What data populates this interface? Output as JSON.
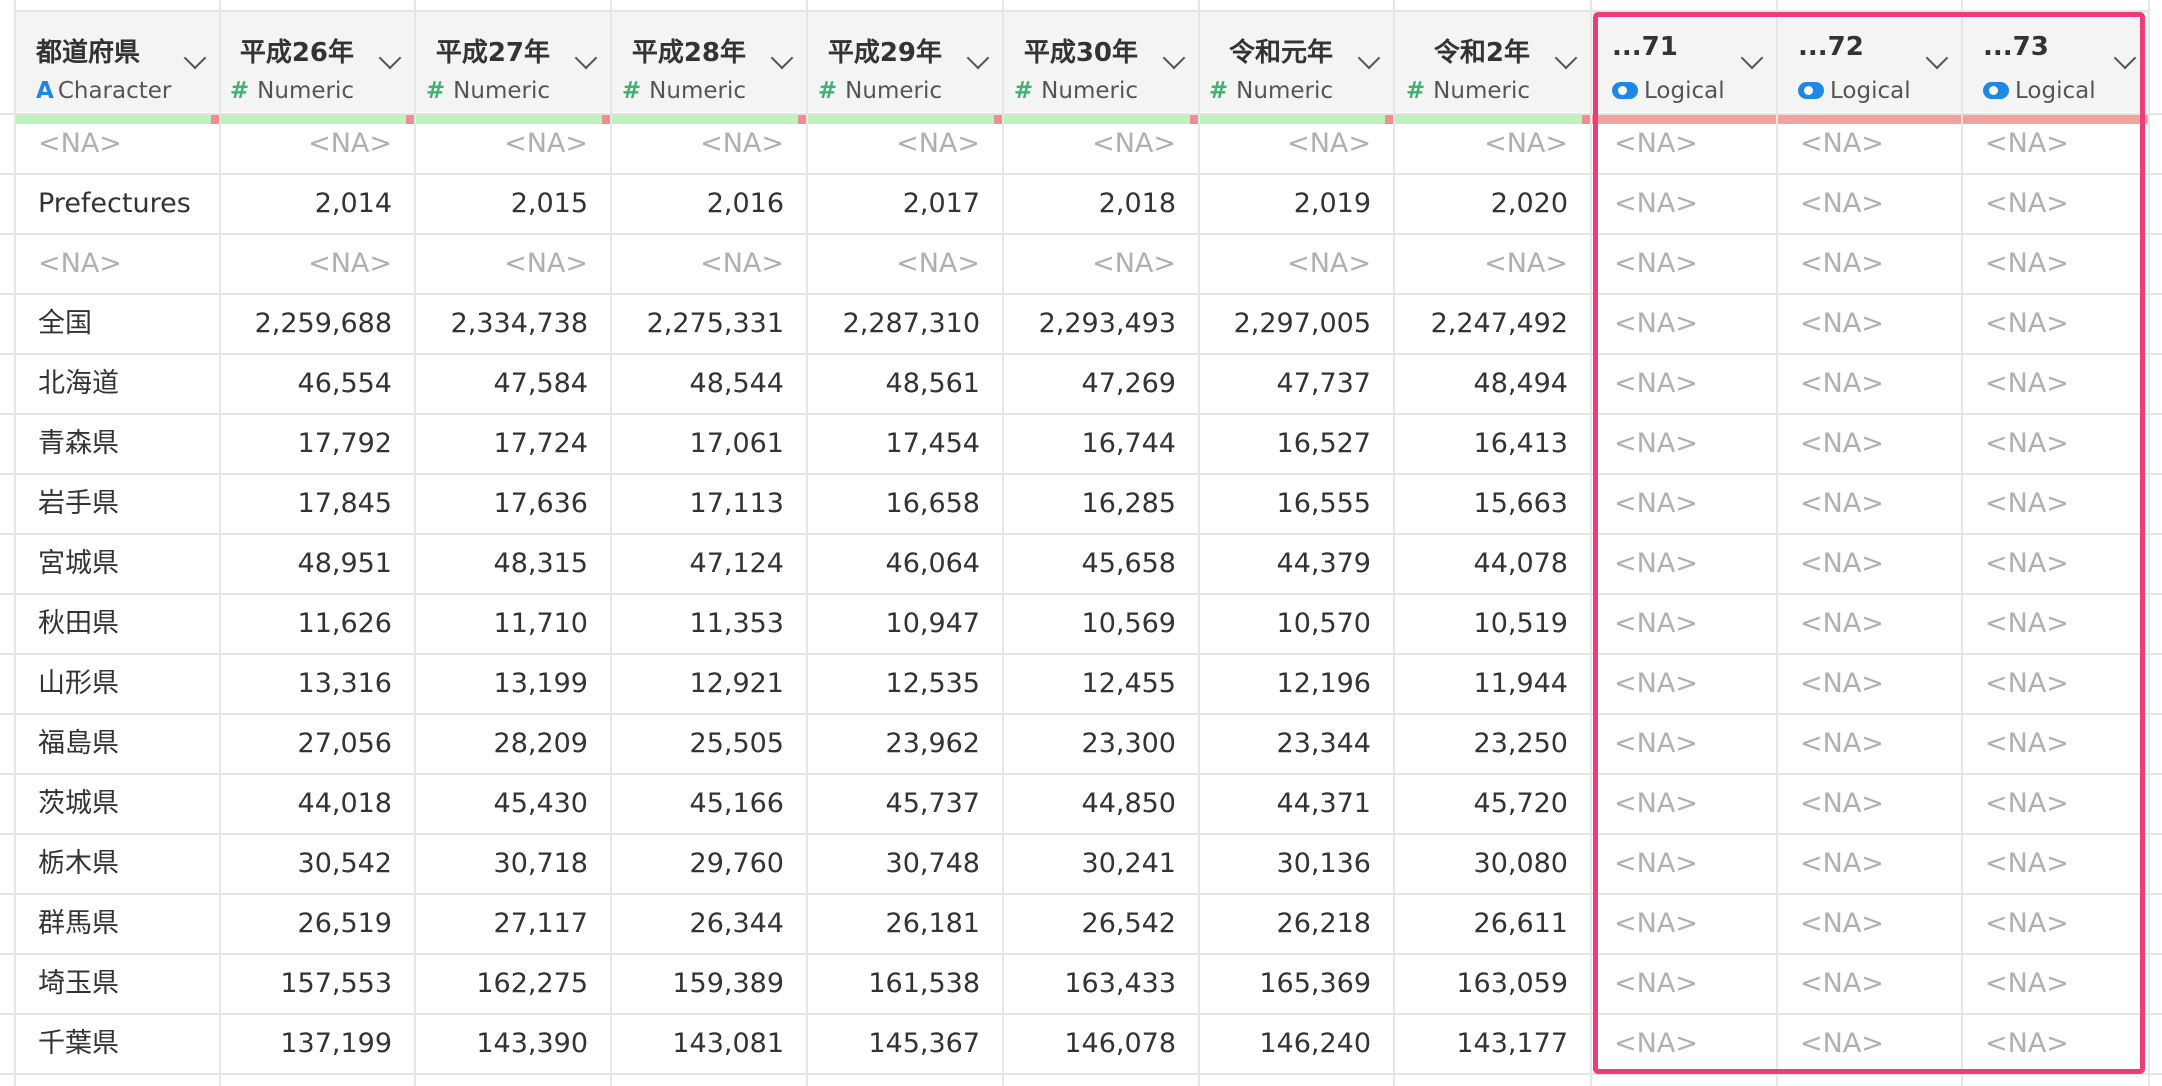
{
  "columns": [
    {
      "name": "都道府県",
      "type": "Character",
      "icon": "character-type-icon",
      "kind": "chr",
      "align": "left"
    },
    {
      "name": "平成26年",
      "type": "Numeric",
      "icon": "numeric-type-icon",
      "kind": "num",
      "align": "right"
    },
    {
      "name": "平成27年",
      "type": "Numeric",
      "icon": "numeric-type-icon",
      "kind": "num",
      "align": "right"
    },
    {
      "name": "平成28年",
      "type": "Numeric",
      "icon": "numeric-type-icon",
      "kind": "num",
      "align": "right"
    },
    {
      "name": "平成29年",
      "type": "Numeric",
      "icon": "numeric-type-icon",
      "kind": "num",
      "align": "right"
    },
    {
      "name": "平成30年",
      "type": "Numeric",
      "icon": "numeric-type-icon",
      "kind": "num",
      "align": "right"
    },
    {
      "name": "令和元年",
      "type": "Numeric",
      "icon": "numeric-type-icon",
      "kind": "num",
      "align": "right"
    },
    {
      "name": "令和2年",
      "type": "Numeric",
      "icon": "numeric-type-icon",
      "kind": "num",
      "align": "right"
    },
    {
      "name": "...71",
      "type": "Logical",
      "icon": "logical-type-icon",
      "kind": "log",
      "align": "left"
    },
    {
      "name": "...72",
      "type": "Logical",
      "icon": "logical-type-icon",
      "kind": "log",
      "align": "left"
    },
    {
      "name": "...73",
      "type": "Logical",
      "icon": "logical-type-icon",
      "kind": "log",
      "align": "left"
    }
  ],
  "na_text": "<NA>",
  "rows": [
    [
      "<NA>",
      "<NA>",
      "<NA>",
      "<NA>",
      "<NA>",
      "<NA>",
      "<NA>",
      "<NA>",
      "<NA>",
      "<NA>",
      "<NA>"
    ],
    [
      "Prefectures",
      "2,014",
      "2,015",
      "2,016",
      "2,017",
      "2,018",
      "2,019",
      "2,020",
      "<NA>",
      "<NA>",
      "<NA>"
    ],
    [
      "<NA>",
      "<NA>",
      "<NA>",
      "<NA>",
      "<NA>",
      "<NA>",
      "<NA>",
      "<NA>",
      "<NA>",
      "<NA>",
      "<NA>"
    ],
    [
      "全国",
      "2,259,688",
      "2,334,738",
      "2,275,331",
      "2,287,310",
      "2,293,493",
      "2,297,005",
      "2,247,492",
      "<NA>",
      "<NA>",
      "<NA>"
    ],
    [
      "北海道",
      "46,554",
      "47,584",
      "48,544",
      "48,561",
      "47,269",
      "47,737",
      "48,494",
      "<NA>",
      "<NA>",
      "<NA>"
    ],
    [
      "青森県",
      "17,792",
      "17,724",
      "17,061",
      "17,454",
      "16,744",
      "16,527",
      "16,413",
      "<NA>",
      "<NA>",
      "<NA>"
    ],
    [
      "岩手県",
      "17,845",
      "17,636",
      "17,113",
      "16,658",
      "16,285",
      "16,555",
      "15,663",
      "<NA>",
      "<NA>",
      "<NA>"
    ],
    [
      "宮城県",
      "48,951",
      "48,315",
      "47,124",
      "46,064",
      "45,658",
      "44,379",
      "44,078",
      "<NA>",
      "<NA>",
      "<NA>"
    ],
    [
      "秋田県",
      "11,626",
      "11,710",
      "11,353",
      "10,947",
      "10,569",
      "10,570",
      "10,519",
      "<NA>",
      "<NA>",
      "<NA>"
    ],
    [
      "山形県",
      "13,316",
      "13,199",
      "12,921",
      "12,535",
      "12,455",
      "12,196",
      "11,944",
      "<NA>",
      "<NA>",
      "<NA>"
    ],
    [
      "福島県",
      "27,056",
      "28,209",
      "25,505",
      "23,962",
      "23,300",
      "23,344",
      "23,250",
      "<NA>",
      "<NA>",
      "<NA>"
    ],
    [
      "茨城県",
      "44,018",
      "45,430",
      "45,166",
      "45,737",
      "44,850",
      "44,371",
      "45,720",
      "<NA>",
      "<NA>",
      "<NA>"
    ],
    [
      "栃木県",
      "30,542",
      "30,718",
      "29,760",
      "30,748",
      "30,241",
      "30,136",
      "30,080",
      "<NA>",
      "<NA>",
      "<NA>"
    ],
    [
      "群馬県",
      "26,519",
      "27,117",
      "26,344",
      "26,181",
      "26,542",
      "26,218",
      "26,611",
      "<NA>",
      "<NA>",
      "<NA>"
    ],
    [
      "埼玉県",
      "157,553",
      "162,275",
      "159,389",
      "161,538",
      "163,433",
      "165,369",
      "163,059",
      "<NA>",
      "<NA>",
      "<NA>"
    ],
    [
      "千葉県",
      "137,199",
      "143,390",
      "143,081",
      "145,367",
      "146,078",
      "146,240",
      "143,177",
      "<NA>",
      "<NA>",
      "<NA>"
    ]
  ],
  "colors": {
    "accent": "#ec3d78",
    "numeric_bar": "#bdf2b8",
    "logical_bar": "#f4a29e",
    "icon_blue": "#1e88e5",
    "icon_green": "#3cb371"
  }
}
